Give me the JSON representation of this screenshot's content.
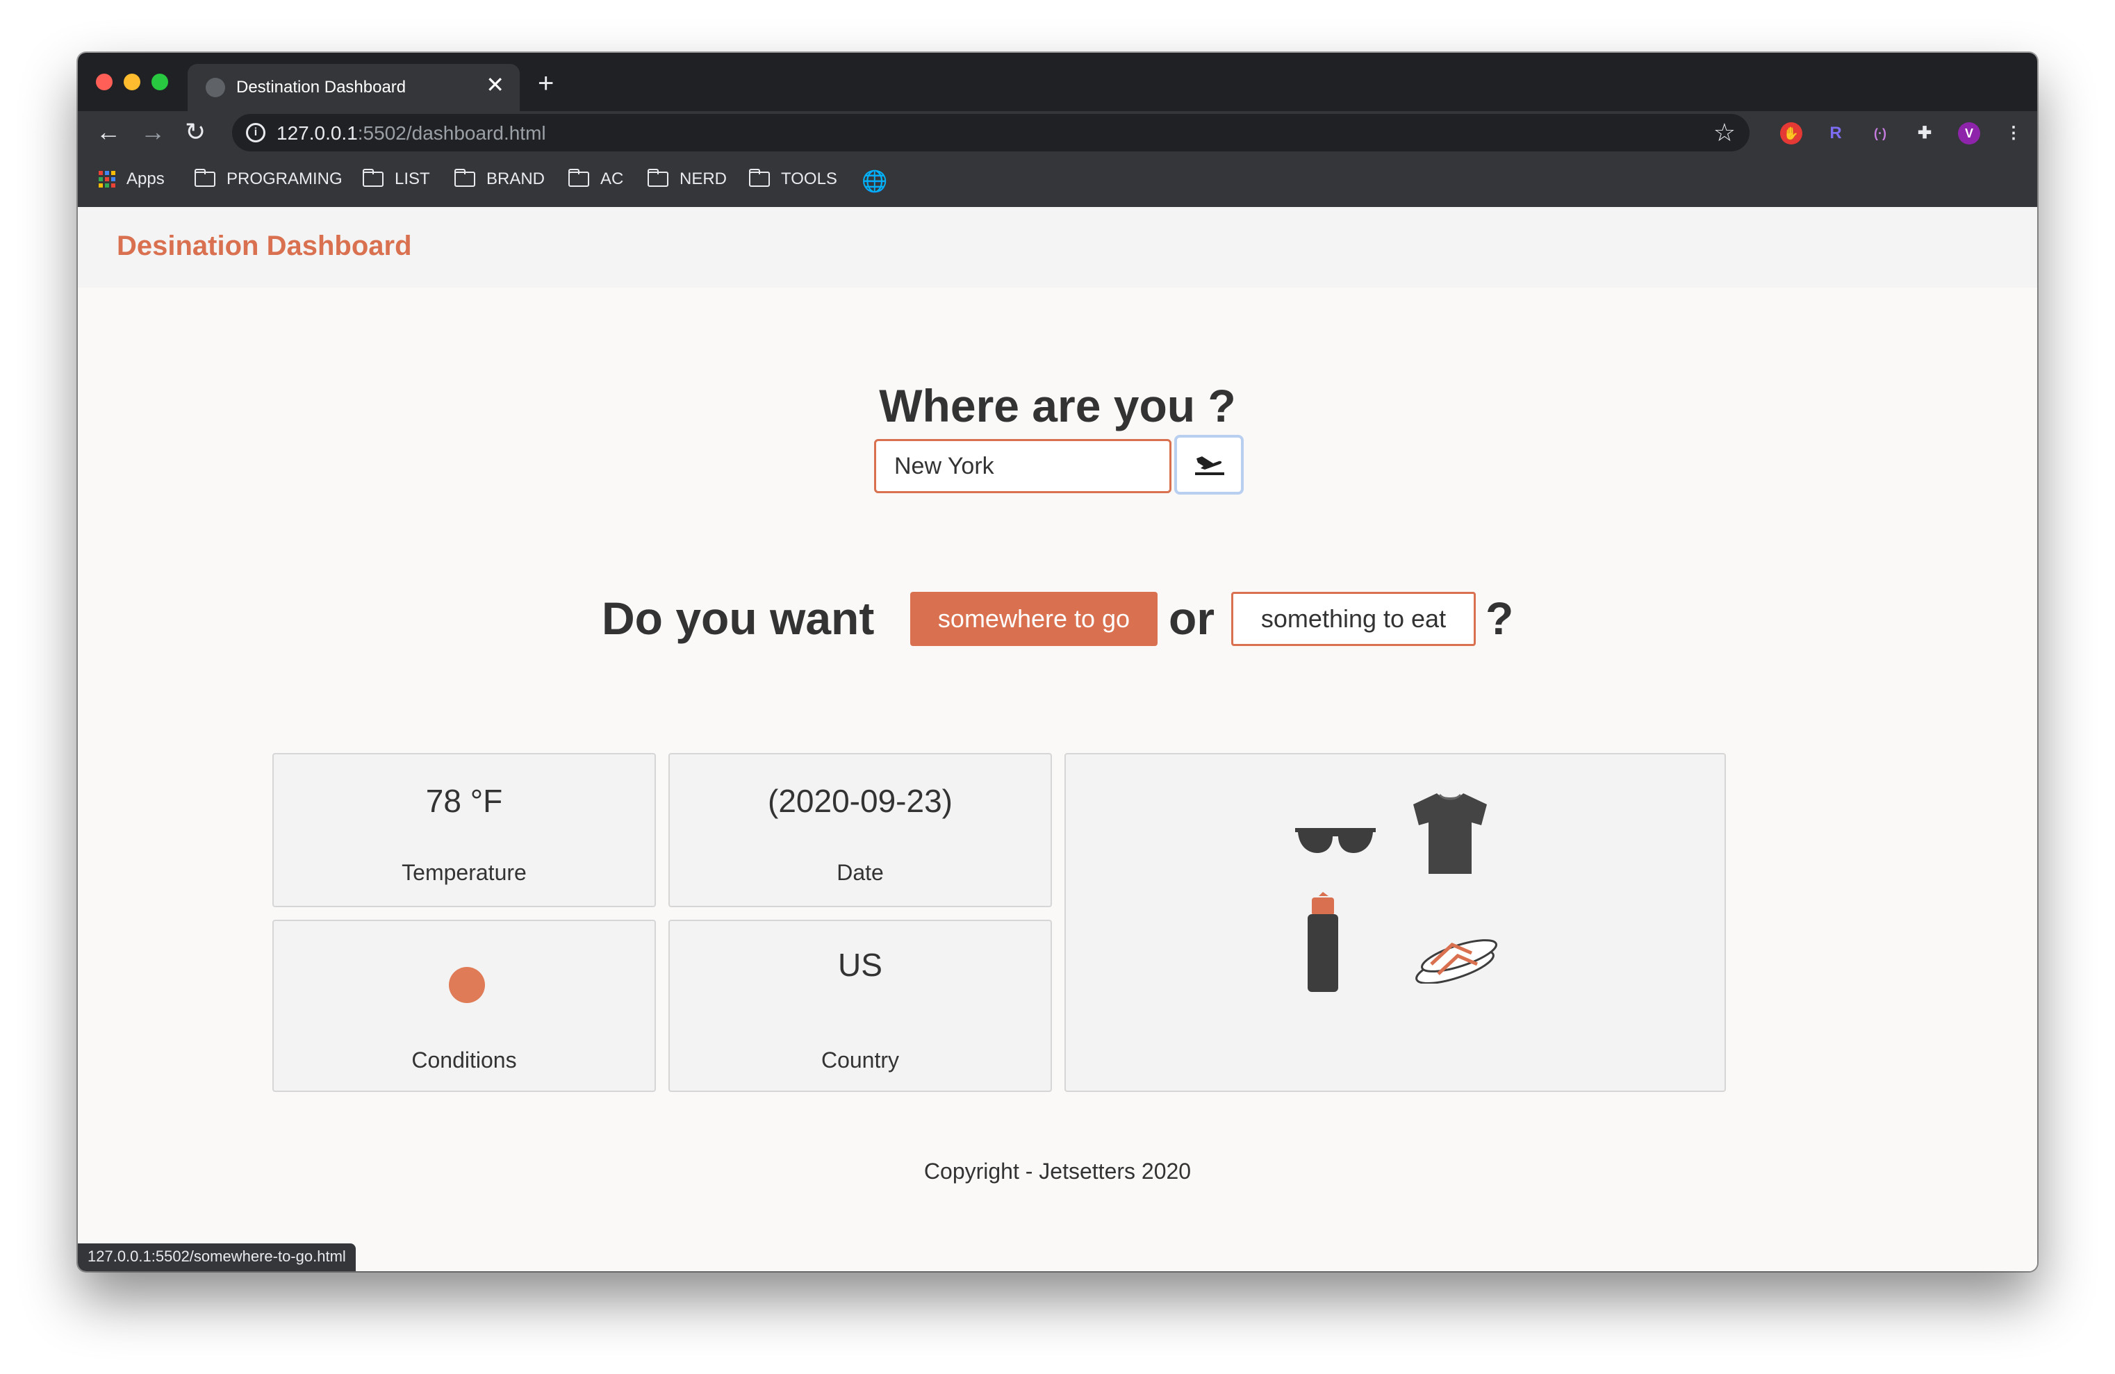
{
  "browser": {
    "tab_title": "Destination Dashboard",
    "new_tab_symbol": "+",
    "close_symbol": "✕",
    "url_host": "127.0.0.1",
    "url_path": ":5502/dashboard.html",
    "bookmarks": [
      "Apps",
      "PROGRAMING",
      "LIST",
      "BRAND",
      "AC",
      "NERD",
      "TOOLS"
    ],
    "profile_initial": "V",
    "status_url": "127.0.0.1:5502/somewhere-to-go.html"
  },
  "page": {
    "brand": "Desination Dashboard",
    "where_question": "Where are you ?",
    "city_value": "New York",
    "city_placeholder": "",
    "want_prefix": "Do you want",
    "option_go": "somewhere to go",
    "or_word": "or",
    "option_eat": "something to eat",
    "want_suffix": "?",
    "footer": "Copyright - Jetsetters 2020"
  },
  "cards": {
    "temperature": {
      "value": "78 °F",
      "label": "Temperature"
    },
    "date": {
      "value": "(2020-09-23)",
      "label": "Date"
    },
    "conditions": {
      "icon": "sun-icon",
      "label": "Conditions"
    },
    "country": {
      "value": "US",
      "label": "Country"
    },
    "packing": {
      "items": [
        "sunglasses-icon",
        "tshirt-icon",
        "water-bottle-icon",
        "flip-flops-icon"
      ]
    }
  },
  "colors": {
    "accent": "#d9704f",
    "text": "#333333",
    "chrome_dark": "#202124",
    "chrome_mid": "#35363a"
  }
}
